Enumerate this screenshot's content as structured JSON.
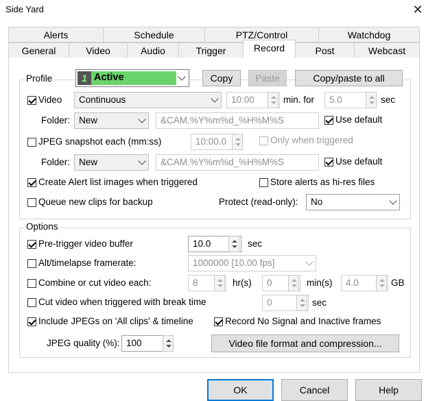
{
  "window": {
    "title": "Side Yard",
    "close_glyph": "✕"
  },
  "tabs_row1": [
    "Alerts",
    "Schedule",
    "PTZ/Control",
    "Watchdog"
  ],
  "tabs_row2": [
    "General",
    "Video",
    "Audio",
    "Trigger",
    "Record",
    "Post",
    "Webcast"
  ],
  "active_tab": "Record",
  "profile": {
    "label": "Profile",
    "number": "1",
    "name": "Active",
    "color": "#6ad36a",
    "copy": "Copy",
    "paste": "Paste",
    "copy_paste_all": "Copy/paste to all"
  },
  "video": {
    "checkbox_label": "Video",
    "checked": true,
    "mode": "Continuous",
    "minutes": "10:00",
    "min_for_label": "min. for",
    "seconds": "5.0",
    "sec_label": "sec",
    "folder_label": "Folder:",
    "folder": "New",
    "filename": "&CAM.%Y%m%d_%H%M%S",
    "use_default_label": "Use default",
    "use_default_checked": true
  },
  "jpeg": {
    "checkbox_label": "JPEG snapshot each (mm:ss)",
    "checked": false,
    "interval": "10:00.0",
    "only_triggered_label": "Only when triggered",
    "only_triggered_checked": false,
    "folder_label": "Folder:",
    "folder": "New",
    "filename": "&CAM.%Y%m%d_%H%M%S",
    "use_default_label": "Use default",
    "use_default_checked": true
  },
  "alert_images": {
    "label": "Create Alert list images when triggered",
    "checked": true
  },
  "store_hires": {
    "label": "Store alerts as hi-res files",
    "checked": false
  },
  "queue_backup": {
    "label": "Queue new clips for backup",
    "checked": false
  },
  "protect": {
    "label": "Protect (read-only):",
    "value": "No"
  },
  "options": {
    "label": "Options",
    "pretrigger": {
      "label": "Pre-trigger video buffer",
      "checked": true,
      "value": "10.0",
      "unit": "sec"
    },
    "framerate": {
      "label": "Alt/timelapse framerate:",
      "checked": false,
      "value": "1000000 [10.00 fps]"
    },
    "combine": {
      "label": "Combine or cut video each:",
      "checked": false,
      "hours": "8",
      "hours_unit": "hr(s)",
      "mins": "0",
      "mins_unit": "min(s)",
      "gb": "4.0",
      "gb_unit": "GB"
    },
    "cut_break": {
      "label": "Cut video when triggered with break time",
      "checked": false,
      "value": "0",
      "unit": "sec"
    },
    "include_jpegs": {
      "label": "Include JPEGs on 'All clips' & timeline",
      "checked": true
    },
    "record_nosignal": {
      "label": "Record No Signal and Inactive frames",
      "checked": true
    },
    "jpeg_quality": {
      "label": "JPEG quality (%):",
      "value": "100"
    },
    "format_button": "Video file format and compression..."
  },
  "buttons": {
    "ok": "OK",
    "cancel": "Cancel",
    "help": "Help"
  }
}
